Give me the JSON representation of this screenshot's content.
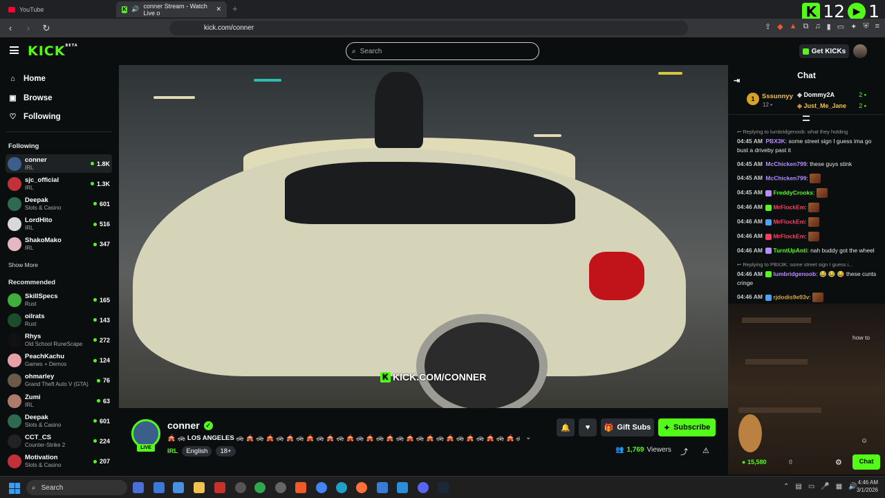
{
  "browser": {
    "tabs": [
      {
        "label": "YouTube"
      },
      {
        "label": "conner Stream - Watch Live o"
      }
    ],
    "url": "kick.com/conner",
    "badge_count_1": "12",
    "badge_count_2": "1"
  },
  "header": {
    "logo": "KICK",
    "logo_tag": "BETA",
    "search_placeholder": "Search",
    "get_kicks": "Get KICKs"
  },
  "sidebar": {
    "nav": [
      {
        "label": "Home"
      },
      {
        "label": "Browse"
      },
      {
        "label": "Following"
      }
    ],
    "following_title": "Following",
    "following": [
      {
        "name": "conner",
        "category": "IRL",
        "viewers": "1.8K",
        "color": "#3b5f8a"
      },
      {
        "name": "sjc_official",
        "category": "IRL",
        "viewers": "1.3K",
        "color": "#c2313a"
      },
      {
        "name": "Deepak",
        "category": "Slots & Casino",
        "viewers": "601",
        "color": "#2d6a4f"
      },
      {
        "name": "LordHito",
        "category": "IRL",
        "viewers": "516",
        "color": "#d9d9d9"
      },
      {
        "name": "ShakoMako",
        "category": "IRL",
        "viewers": "347",
        "color": "#e4b7c2"
      }
    ],
    "show_more": "Show More",
    "recommended_title": "Recommended",
    "recommended": [
      {
        "name": "SkillSpecs",
        "category": "Rust",
        "viewers": "165",
        "color": "#3fae3a"
      },
      {
        "name": "oilrats",
        "category": "Rust",
        "viewers": "143",
        "color": "#1c4d2b"
      },
      {
        "name": "Rhys",
        "category": "Old School RuneScape",
        "viewers": "272",
        "color": "#111111"
      },
      {
        "name": "PeachKachu",
        "category": "Games + Demos",
        "viewers": "124",
        "color": "#e7a0a6"
      },
      {
        "name": "ohmarley",
        "category": "Grand Theft Auto V (GTA)",
        "viewers": "76",
        "color": "#6b5a4a"
      },
      {
        "name": "Zumi",
        "category": "IRL",
        "viewers": "63",
        "color": "#b07a6a"
      },
      {
        "name": "Deepak",
        "category": "Slots & Casino",
        "viewers": "601",
        "color": "#2d6a4f"
      },
      {
        "name": "CCT_CS",
        "category": "Counter-Strike 2",
        "viewers": "224",
        "color": "#222222"
      },
      {
        "name": "Motivation",
        "category": "Slots & Casino",
        "viewers": "207",
        "color": "#c2313a"
      }
    ]
  },
  "video": {
    "watermark": "KICK.COM/CONNER"
  },
  "stream": {
    "streamer": "conner",
    "live": "LIVE",
    "title": "🎪 🚓 LOS ANGELES 🚓 🎪 🚓 🎪 🚓 🎪 🚓 🎪 🚓 🎪 🚓 🎪 🚓 🎪 🚓 🎪 🚓 🎪 🚓 🎪 🚓 🎪 🚓 🎪 🚓 🎪 🚓 🎪 🚓 ...",
    "category": "IRL",
    "tags": [
      "English",
      "18+"
    ],
    "gift_subs": "Gift Subs",
    "subscribe": "Subscribe",
    "viewers": "1,769",
    "viewers_label": "Viewers"
  },
  "chat": {
    "title": "Chat",
    "leaderboard": {
      "first": {
        "rank": "1",
        "name": "Sssunnyy",
        "count": "12"
      },
      "second": {
        "name": "Dommy2A",
        "count": "2"
      },
      "third": {
        "name": "Just_Me_Jane",
        "count": "2"
      }
    },
    "messages": [
      {
        "reply": "Replying to lumbridgenoob: what they holding",
        "time": "04:45 AM",
        "user": "PBX3K",
        "color": "#b78cff",
        "text": "some street sign I guess ima go bust a driveby past it"
      },
      {
        "reply": "",
        "time": "04:45 AM",
        "user": "McChicken799",
        "color": "#b78cff",
        "text": "these guys stink"
      },
      {
        "reply": "",
        "time": "04:45 AM",
        "user": "McChicken799",
        "color": "#b78cff",
        "text": ""
      },
      {
        "reply": "",
        "time": "04:45 AM",
        "user": "FreddyCrooks",
        "color": "#53fc18",
        "text": ""
      },
      {
        "reply": "",
        "time": "04:46 AM",
        "user": "MrFlockEm",
        "color": "#ff3b5c",
        "text": ""
      },
      {
        "reply": "",
        "time": "04:46 AM",
        "user": "MrFlockEm",
        "color": "#ff3b5c",
        "text": ""
      },
      {
        "reply": "",
        "time": "04:46 AM",
        "user": "MrFlockEm",
        "color": "#ff3b5c",
        "text": ""
      },
      {
        "reply": "",
        "time": "04:46 AM",
        "user": "TurntUpAnti",
        "color": "#53fc18",
        "text": "nah buddy got the wheel"
      },
      {
        "reply": "Replying to PBX3K: some street sign I guess i...",
        "time": "04:46 AM",
        "user": "lumbridgenoob",
        "color": "#b78cff",
        "text": "😂 😂 😂 these cunts cringe"
      },
      {
        "reply": "",
        "time": "04:46 AM",
        "user": "rjdodis9e93v",
        "color": "#d9a441",
        "text": ""
      }
    ],
    "partial_text": "how to",
    "points": "15,580",
    "count_zero": "0",
    "send": "Chat"
  },
  "taskbar": {
    "search": "Search",
    "time": "4:46 AM",
    "date": "3/1/2026"
  }
}
